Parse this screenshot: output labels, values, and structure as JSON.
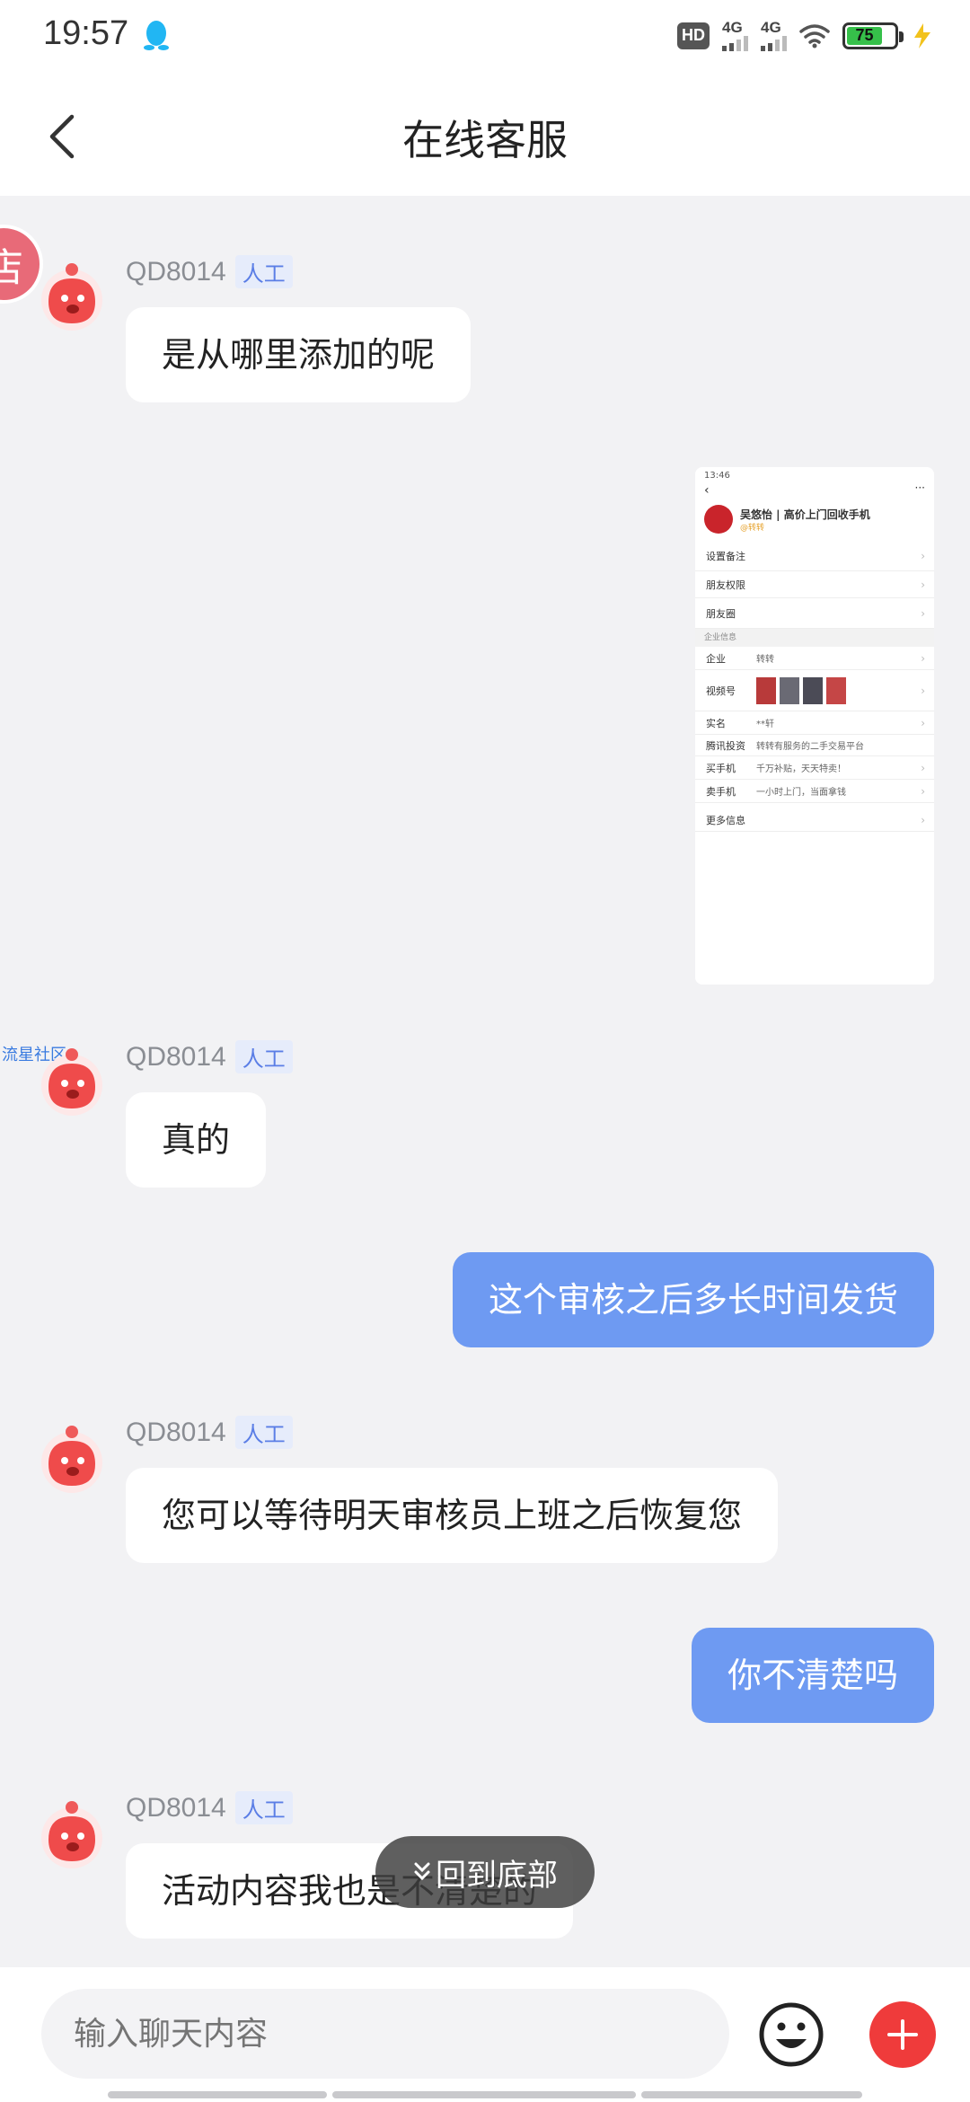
{
  "status_bar": {
    "time": "19:57",
    "hd_label": "HD",
    "network_1": "4G",
    "network_2": "4G",
    "battery": "75"
  },
  "header": {
    "title": "在线客服"
  },
  "messages": [
    {
      "sender": "QD8014",
      "tag": "人工",
      "text": "是从哪里添加的呢"
    },
    {
      "sender": "me",
      "type": "image"
    },
    {
      "sender": "QD8014",
      "tag": "人工",
      "text": "真的"
    },
    {
      "sender": "me",
      "text": "这个审核之后多长时间发货"
    },
    {
      "sender": "QD8014",
      "tag": "人工",
      "text": "您可以等待明天审核员上班之后恢复您"
    },
    {
      "sender": "me",
      "text": "你不清楚吗"
    },
    {
      "sender": "QD8014",
      "tag": "人工",
      "text": "活动内容我也是不清楚的"
    }
  ],
  "side_badge": "店",
  "side_text": "流星社区",
  "shared_image": {
    "time": "13:46",
    "contact_name": "吴悠怡 | 高价上门回收手机",
    "contact_sub": "@转转",
    "rows": [
      {
        "key": "设置备注",
        "value": ""
      },
      {
        "key": "朋友权限",
        "value": ""
      },
      {
        "key": "朋友圈",
        "value": ""
      },
      {
        "key": "企业",
        "value": "转转"
      },
      {
        "key": "视频号",
        "value": ""
      },
      {
        "key": "实名",
        "value": "**轩"
      },
      {
        "key": "腾讯投资",
        "value": "转转有服务的二手交易平台"
      },
      {
        "key": "买手机",
        "value": "千万补贴，天天特卖！"
      },
      {
        "key": "卖手机",
        "value": "一小时上门，当面拿钱"
      },
      {
        "key": "更多信息",
        "value": ""
      }
    ],
    "section_label": "企业信息"
  },
  "back_to_bottom": "回到底部",
  "input": {
    "placeholder": "输入聊天内容"
  },
  "colors": {
    "accent": "#6e9af2",
    "plus": "#ef3b3b",
    "tag_text": "#5b7ee6"
  }
}
